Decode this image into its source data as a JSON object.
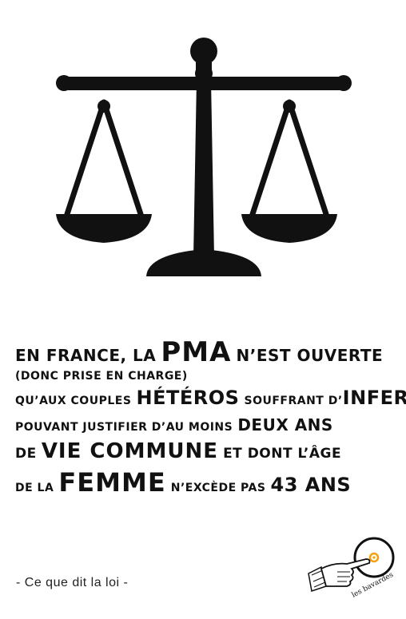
{
  "statement": {
    "line1": {
      "a": "En France, la",
      "b": "PMA",
      "c": "n’est ouverte"
    },
    "line2": {
      "a": "(donc prise en charge)"
    },
    "line3": {
      "a": "qu’aux couples",
      "b": "hétéros",
      "c": "souffrant d’",
      "d": "infertilité,"
    },
    "line4": {
      "a": "pouvant justifier d’au moins",
      "b": "deux ans"
    },
    "line5": {
      "a": "de",
      "b": "vie commune",
      "c": "et dont l’âge"
    },
    "line6": {
      "a": "de la",
      "b": "femme",
      "c": "n’excède pas",
      "d": "43 ans"
    }
  },
  "source": "- Ce que dit la loi -",
  "logo_text": "les bavardes",
  "icons": {
    "main": "balance-scale-icon",
    "logo": "pointing-hand-logo"
  },
  "colors": {
    "ink": "#111111",
    "background": "#ffffff",
    "accent": "#f2a20c"
  }
}
